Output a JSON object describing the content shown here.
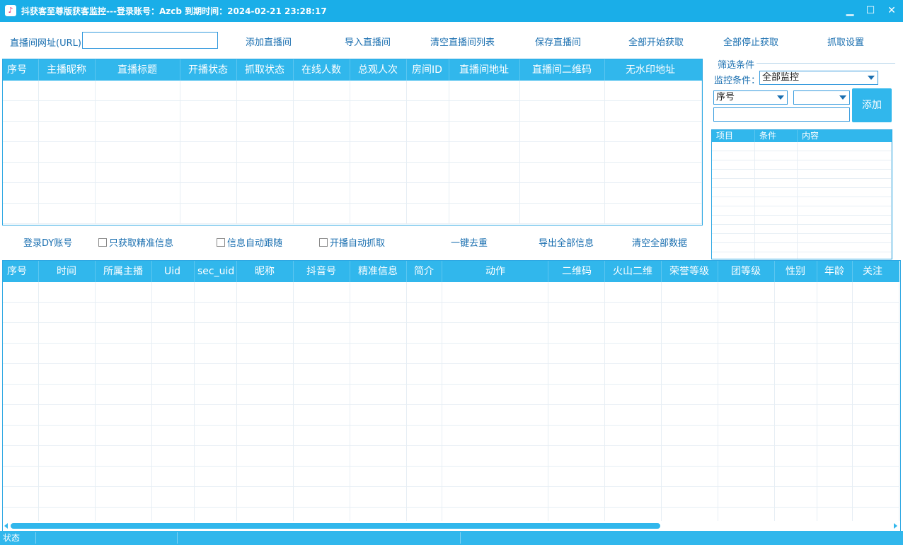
{
  "window": {
    "title": "抖获客至尊版获客监控---登录账号：Azcb   到期时间：2024-02-21 23:28:17",
    "icon": "tiktok-icon",
    "min_glyph": "▁",
    "max_glyph": "☐",
    "close_glyph": "✕"
  },
  "toolbar": {
    "url_label": "直播间网址(URL)：",
    "url_value": "",
    "buttons": [
      "添加直播间",
      "导入直播间",
      "清空直播间列表",
      "保存直播间",
      "全部开始获取",
      "全部停止获取",
      "抓取设置"
    ]
  },
  "rooms_table": {
    "columns": [
      "序号",
      "主播昵称",
      "直播标题",
      "开播状态",
      "抓取状态",
      "在线人数",
      "总观人次",
      "房间ID",
      "直播间地址",
      "直播间二维码",
      "无水印地址"
    ],
    "rows": []
  },
  "filter": {
    "group_title": "筛选条件",
    "monitor_label": "监控条件：",
    "monitor_value": "全部监控",
    "field_value": "序号",
    "operator_value": "",
    "text_value": "",
    "add_label": "添加",
    "columns": [
      "项目",
      "条件",
      "内容"
    ]
  },
  "middle": {
    "login_label": "登录DY账号",
    "checkboxes": [
      {
        "label": "只获取精准信息",
        "checked": false
      },
      {
        "label": "信息自动跟随",
        "checked": false
      },
      {
        "label": "开播自动抓取",
        "checked": false
      }
    ],
    "dedupe_label": "一键去重",
    "export_label": "导出全部信息",
    "clear_label": "清空全部数据"
  },
  "customers_table": {
    "columns": [
      "序号",
      "时间",
      "所属主播",
      "Uid",
      "sec_uid",
      "昵称",
      "抖音号",
      "精准信息",
      "简介",
      "动作",
      "二维码",
      "火山二维",
      "荣誉等级",
      "团等级",
      "性别",
      "年龄",
      "关注"
    ],
    "rows": []
  },
  "statusbar": {
    "label": "状态"
  },
  "colors": {
    "accent": "#31b7ec",
    "title_bar": "#1aaee8",
    "link_text": "#1a6fb0"
  }
}
